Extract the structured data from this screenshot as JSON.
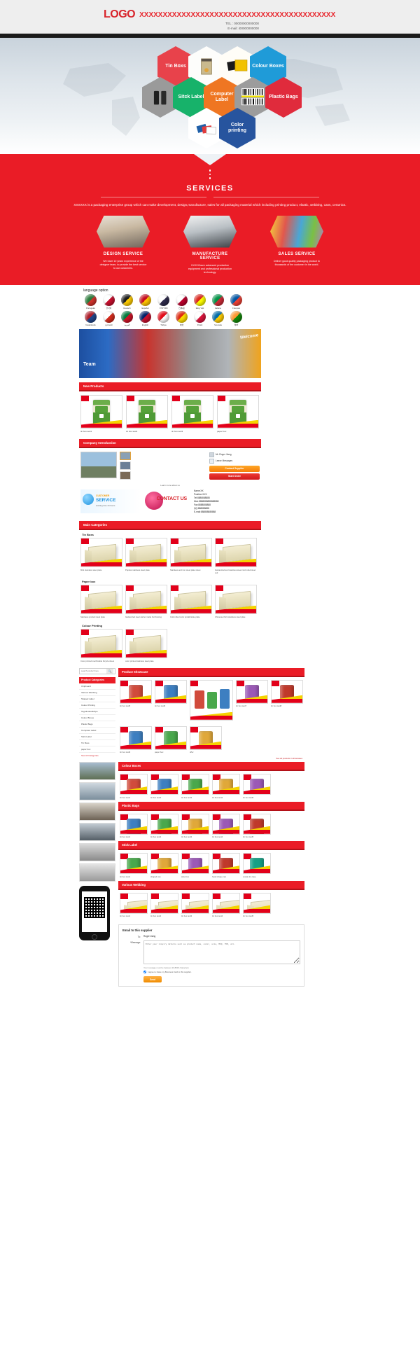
{
  "header": {
    "logo": "LOGO",
    "company_x": "XXXXXXXXXXXXXXXXXXXXXXXXXXXXXXXXXXXXXXXXXX",
    "tel": "TEL : 00000000000000",
    "email": "E-mail: i00000000000"
  },
  "hero": {
    "hexes": [
      {
        "label": "Tin Boxs",
        "color": "#e8424b",
        "type": "text"
      },
      {
        "label": "",
        "color": "#ffffff",
        "type": "image",
        "image": "tin-box-photo"
      },
      {
        "label": "",
        "color": "#ffffff",
        "type": "image",
        "image": "yellow-folder-photo"
      },
      {
        "label": "Colour Boxes",
        "color": "#1f9bd8",
        "type": "text"
      },
      {
        "label": "",
        "color": "#9a9a9a",
        "type": "image",
        "image": "hang-tag-photo"
      },
      {
        "label": "Sitck Label",
        "color": "#17b26a",
        "type": "text"
      },
      {
        "label": "Computer Label",
        "color": "#ef7622",
        "type": "text"
      },
      {
        "label": "",
        "color": "#9a9a9a",
        "type": "image",
        "image": "barcode-photo"
      },
      {
        "label": "Plastic Bags",
        "color": "#e02b3c",
        "type": "text"
      },
      {
        "label": "",
        "color": "#ffffff",
        "type": "image",
        "image": "brochure-photo"
      },
      {
        "label": "Color printing",
        "color": "#27549e",
        "type": "text"
      }
    ]
  },
  "services": {
    "title": "SERVICES",
    "description": "XXXXXX is a packaging enterprise group which can make development, design,manufacture, sales for all packaging material which including printing product, elastic, webbing, cans, ceramics.",
    "cards": [
      {
        "name": "DESIGN SERVICE",
        "body": "We have 10 years experience of the designer team, to provide the best service to our customers."
      },
      {
        "name": "MANUFACTURE SERVICE",
        "body": "XXXXXhave advanced production equipment and professional production technology."
      },
      {
        "name": "SALES SERVICE",
        "body": "Deliver good quality packaging product to thousands of the customer in the world."
      }
    ]
  },
  "language": {
    "label": "language option",
    "flags": [
      {
        "name": "Português",
        "c1": "#2a7a3a",
        "c2": "#d1322c"
      },
      {
        "name": "한국어",
        "c1": "#ffffff",
        "c2": "#c8102e"
      },
      {
        "name": "Deutsch",
        "c1": "#1a1a1a",
        "c2": "#ffcc00"
      },
      {
        "name": "Español",
        "c1": "#c60b1e",
        "c2": "#ffc400"
      },
      {
        "name": "ภาษาไทย",
        "c1": "#ffffff",
        "c2": "#2d2a4a"
      },
      {
        "name": "日本語",
        "c1": "#ffffff",
        "c2": "#bc002d"
      },
      {
        "name": "tiếng Việt",
        "c1": "#da251d",
        "c2": "#ffff00"
      },
      {
        "name": "Italiano",
        "c1": "#009246",
        "c2": "#ce2b37"
      },
      {
        "name": "Français",
        "c1": "#0055a4",
        "c2": "#ef4135"
      },
      {
        "name": "Nederlands",
        "c1": "#ae1c28",
        "c2": "#21468b"
      },
      {
        "name": "русский",
        "c1": "#ffffff",
        "c2": "#d52b1e"
      },
      {
        "name": "العربية",
        "c1": "#007a3d",
        "c2": "#ce1126"
      },
      {
        "name": "English",
        "c1": "#012169",
        "c2": "#c8102e"
      },
      {
        "name": "Türkçe",
        "c1": "#e30a17",
        "c2": "#ffffff"
      },
      {
        "name": "中文",
        "c1": "#de2910",
        "c2": "#ffde00"
      },
      {
        "name": "Polski",
        "c1": "#ffffff",
        "c2": "#dc143c"
      },
      {
        "name": "Svenska",
        "c1": "#006aa7",
        "c2": "#fecc00"
      },
      {
        "name": "हिन्दी",
        "c1": "#ff9933",
        "c2": "#138808"
      }
    ]
  },
  "banner": {
    "team": "Team",
    "welcome": "Welcome"
  },
  "new_products": {
    "heading": "New Products",
    "items": [
      {
        "caption": "tin box test1"
      },
      {
        "caption": "tin box test2"
      },
      {
        "caption": "tin box test3"
      },
      {
        "caption": "paper box"
      }
    ]
  },
  "company_intro": {
    "heading": "Company Introduction",
    "contact_name": "Mr. Roger Jiang",
    "leave_message": "Leave Messages",
    "contact_supplier_button": "Contact Supplier",
    "start_order_button": "Start Order",
    "learn_more": "Learn more about us"
  },
  "contact_band": {
    "service_small": "CUSTOMER",
    "service_big": "SERVICE",
    "service_sub": "working time 24 hours",
    "contact_us": "CONTACT US",
    "contact_label": "CONTACT",
    "lines": [
      "Name:XX",
      "Position:XXX",
      "Tel:8888888888",
      "Mob:8888888888888888",
      "Fax:8888888888",
      "QQ:888888888",
      "E-mail:888888888888"
    ]
  },
  "main_categories": {
    "heading": "Main Categories",
    "groups": [
      {
        "title": "Tin Boxs",
        "items": [
          {
            "caption": "Mini stainless steel plate"
          },
          {
            "caption": "Popular stainless steel plate"
          },
          {
            "caption": "Stainless and iron steel plate sheet"
          },
          {
            "caption": "Galvanized and stainless steel cold rolled steel coil"
          }
        ]
      },
      {
        "title": "Paper box",
        "items": [
          {
            "caption": "Stainless product steel plate"
          },
          {
            "caption": "Galvanized steel carrier matte hot framing"
          },
          {
            "caption": "Cold rolled color prefabricate plate"
          },
          {
            "caption": "Chinesse thick stainless steel plate"
          }
        ]
      },
      {
        "title": "Colour Printing",
        "items": [
          {
            "caption": "Color printed machinable bicycle sheet"
          },
          {
            "caption": "color printed stainless steel plate"
          }
        ]
      }
    ]
  },
  "sidebar": {
    "search_placeholder": "search product here",
    "search_icon": "search-icon",
    "categories_heading": "Product Categories",
    "items": [
      "Chipboard",
      "Various Webbing",
      "Shaped Label",
      "Colour Printing",
      "Tags&Label&Pipe",
      "Colour Boxes",
      "Plastic Bags",
      "Computer Label",
      "Stick Label",
      "Tin Boxs",
      "paper box"
    ],
    "see_all": "See All Categories"
  },
  "showcase": {
    "heading": "Product Showcase",
    "items": [
      {
        "caption": "tin box test5"
      },
      {
        "caption": "tin box test6"
      },
      {
        "caption": "tin box test7"
      },
      {
        "caption": "tin box test8"
      },
      {
        "caption": "tin box test9"
      },
      {
        "caption": "paper box"
      },
      {
        "caption": "offer"
      }
    ],
    "see_all": "See all products in showcases"
  },
  "sections": [
    {
      "heading": "Colour Boxes",
      "items": [
        {
          "caption": "tin box test1"
        },
        {
          "caption": "tin box test2"
        },
        {
          "caption": "tin box test3"
        },
        {
          "caption": "tin box test4"
        },
        {
          "caption": "tin box test5"
        }
      ]
    },
    {
      "heading": "Plastic Bags",
      "items": [
        {
          "caption": "tin box test1"
        },
        {
          "caption": "tin box test2"
        },
        {
          "caption": "tin box test3"
        },
        {
          "caption": "tin box test4"
        },
        {
          "caption": "tin box test5"
        }
      ]
    },
    {
      "heading": "Stick Label",
      "items": [
        {
          "caption": "tin box test1"
        },
        {
          "caption": "shaped can"
        },
        {
          "caption": "wine box"
        },
        {
          "caption": "heart shape can"
        },
        {
          "caption": "cookie tin case"
        }
      ]
    },
    {
      "heading": "Various Webbing",
      "items": [
        {
          "caption": "tin box test1"
        },
        {
          "caption": "tin box test2"
        },
        {
          "caption": "tin box test3"
        },
        {
          "caption": "tin box test4"
        },
        {
          "caption": "tin box test5"
        }
      ]
    }
  ],
  "email_form": {
    "title": "Email to this supplier",
    "to_label": "To:",
    "to_value": "Roger Jiang",
    "message_label": "*Message:",
    "message_placeholder": "Enter your inquiry details such as product name, color, size, MOQ, FOB, etc.",
    "note": "Your message must be between 20-8000 characters",
    "agree_text": "I agree to share my Business Card to this supplier.",
    "send_button": "Send"
  },
  "colors": {
    "brand_red": "#ea1c26",
    "accent_orange": "#f08c00",
    "dark_bar": "#1a1a1a"
  }
}
